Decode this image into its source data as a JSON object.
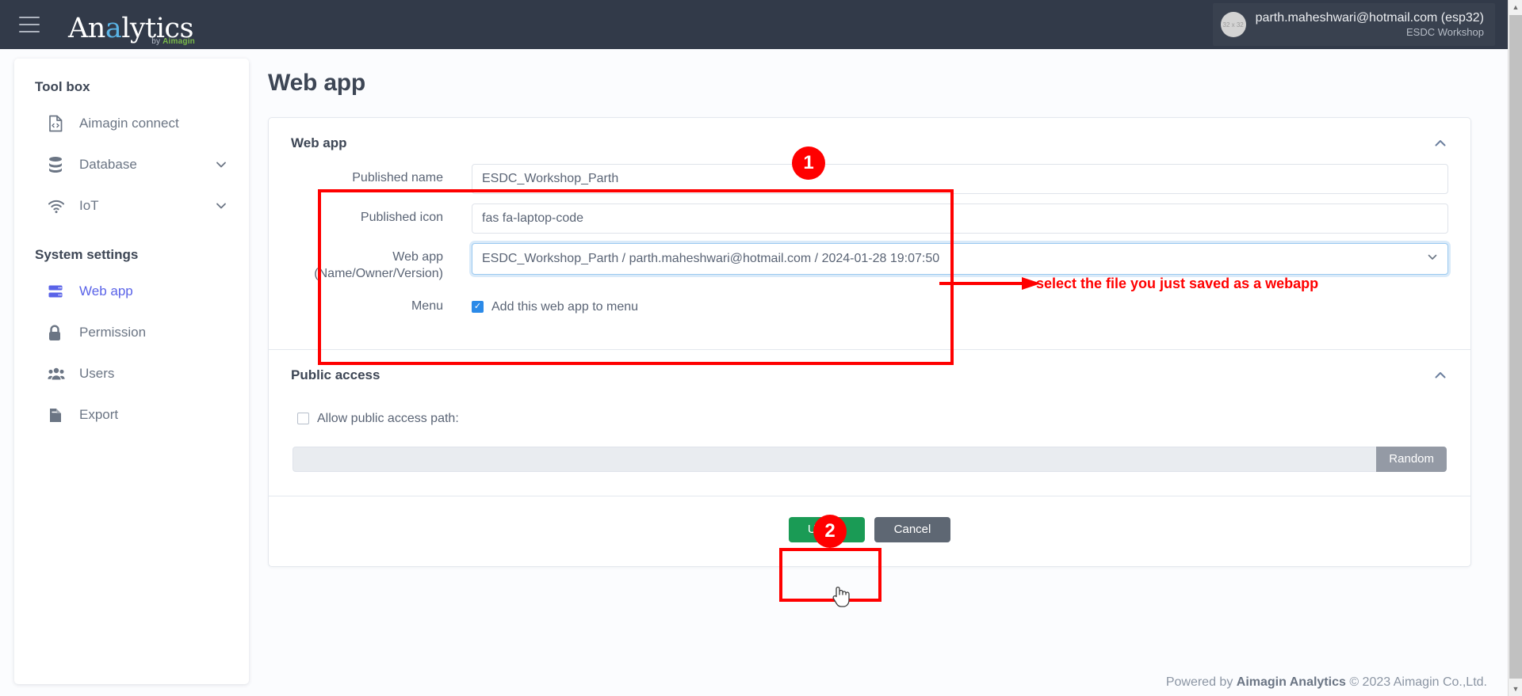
{
  "topbar": {
    "menu_icon": "hamburger-icon",
    "brand_prefix": "An",
    "brand_highlight": "a",
    "brand_suffix": "lytics",
    "brand_sub_by": "by ",
    "brand_sub_name": "Aimagin",
    "avatar_placeholder": "32 x 32",
    "user_email": "parth.maheshwari@hotmail.com (esp32)",
    "user_org": "ESDC Workshop"
  },
  "sidebar": {
    "groups": [
      {
        "title": "Tool box",
        "items": [
          {
            "label": "Aimagin connect",
            "icon": "file-code-icon",
            "active": false,
            "expandable": false
          },
          {
            "label": "Database",
            "icon": "database-icon",
            "active": false,
            "expandable": true
          },
          {
            "label": "IoT",
            "icon": "wifi-icon",
            "active": false,
            "expandable": true
          }
        ]
      },
      {
        "title": "System settings",
        "items": [
          {
            "label": "Web app",
            "icon": "server-icon",
            "active": true,
            "expandable": false
          },
          {
            "label": "Permission",
            "icon": "lock-icon",
            "active": false,
            "expandable": false
          },
          {
            "label": "Users",
            "icon": "users-icon",
            "active": false,
            "expandable": false
          },
          {
            "label": "Export",
            "icon": "export-file-icon",
            "active": false,
            "expandable": false
          }
        ]
      }
    ]
  },
  "page": {
    "title": "Web app"
  },
  "webapp_panel": {
    "title": "Web app",
    "collapse_icon": "chevron-up-icon",
    "fields": {
      "published_name_label": "Published name",
      "published_name_value": "ESDC_Workshop_Parth",
      "published_icon_label": "Published icon",
      "published_icon_value": "fas fa-laptop-code",
      "webapp_label_line1": "Web app",
      "webapp_label_line2": "(Name/Owner/Version)",
      "webapp_selected": "ESDC_Workshop_Parth / parth.maheshwari@hotmail.com / 2024-01-28 19:07:50",
      "menu_label": "Menu",
      "menu_checkbox_label": "Add this web app to menu",
      "menu_checkbox_checked": true
    }
  },
  "public_panel": {
    "title": "Public access",
    "collapse_icon": "chevron-up-icon",
    "allow_label": "Allow public access path:",
    "allow_checked": false,
    "path_value": "",
    "random_button": "Random"
  },
  "actions": {
    "update_label": "Update",
    "cancel_label": "Cancel"
  },
  "annotations": {
    "badge_one": "1",
    "badge_two": "2",
    "select_hint": "select the file you just saved as a webapp",
    "accent_color": "#ff0000"
  },
  "footer": {
    "prefix": "Powered by ",
    "brand": "Aimagin Analytics",
    "suffix": " © 2023 Aimagin Co.,Ltd."
  }
}
